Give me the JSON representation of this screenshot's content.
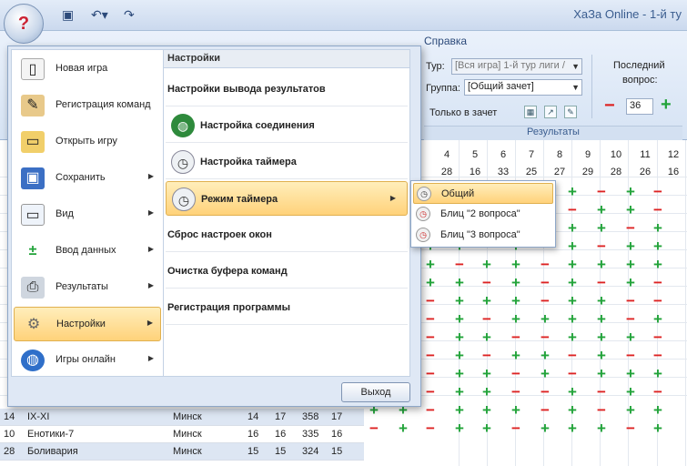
{
  "window": {
    "title": "ХаЗа Online - 1-й ту"
  },
  "orb": {
    "glyph": "?"
  },
  "qat": {
    "save_icon": "floppy-icon",
    "undo_icon": "undo-icon",
    "redo_icon": "redo-icon"
  },
  "ribbon": {
    "tab_help": "Справка",
    "tour_label": "Тур:",
    "tour_value": "[Вся игра] 1-й тур лиги /",
    "group_label": "Группа:",
    "group_value": "[Общий зачет]",
    "only_scoring": "Только в зачет",
    "last_question_label1": "Последний",
    "last_question_label2": "вопрос:",
    "last_question_value": "36",
    "minus_glyph": "−",
    "plus_glyph": "+",
    "results_caption": "Результаты"
  },
  "grid": {
    "question_numbers": [
      "4",
      "5",
      "6",
      "7",
      "8",
      "9",
      "10",
      "11",
      "12"
    ],
    "answer_counts": [
      "28",
      "16",
      "33",
      "25",
      "27",
      "29",
      "28",
      "26",
      "16"
    ],
    "rows": [
      {
        "place": "14",
        "team": "IX-XI",
        "city": "Минск",
        "c1": "14",
        "c2": "17",
        "c3": "358",
        "c4": "17"
      },
      {
        "place": "10",
        "team": "Енотики-7",
        "city": "Минск",
        "c1": "16",
        "c2": "16",
        "c3": "335",
        "c4": "16"
      },
      {
        "place": "28",
        "team": "Боливария",
        "city": "Минск",
        "c1": "15",
        "c2": "15",
        "c3": "324",
        "c4": "15"
      }
    ]
  },
  "menu": {
    "left_items": [
      {
        "label": "Новая игра",
        "icon": "document-icon"
      },
      {
        "label": "Регистрация команд",
        "icon": "clipboard-icon"
      },
      {
        "label": "Открыть игру",
        "icon": "folder-icon"
      },
      {
        "label": "Сохранить",
        "icon": "floppy-icon"
      },
      {
        "label": "Вид",
        "icon": "presentation-icon"
      },
      {
        "label": "Ввод данных",
        "icon": "plus-minus-icon"
      },
      {
        "label": "Результаты",
        "icon": "printer-icon"
      },
      {
        "label": "Настройки",
        "icon": "gear-icon"
      },
      {
        "label": "Игры онлайн",
        "icon": "globe-icon"
      }
    ],
    "right_header": "Настройки",
    "right_items": [
      {
        "label": "Настройки вывода результатов"
      },
      {
        "label": "Настройка соединения",
        "icon": "globe-icon"
      },
      {
        "label": "Настройка таймера",
        "icon": "stopwatch-icon"
      },
      {
        "label": "Режим таймера",
        "icon": "stopwatch-icon"
      },
      {
        "label": "Сброс настроек окон"
      },
      {
        "label": "Очистка буфера команд"
      },
      {
        "label": "Регистрация программы"
      }
    ],
    "exit_label": "Выход"
  },
  "submenu": {
    "items": [
      {
        "label": "Общий",
        "icon": "stopwatch-icon"
      },
      {
        "label": "Блиц \"2 вопроса\"",
        "icon": "alarm-clock-icon"
      },
      {
        "label": "Блиц \"3 вопроса\"",
        "icon": "alarm-clock-icon"
      }
    ]
  },
  "colors": {
    "plus": "#22a33a",
    "minus": "#d22",
    "highlight": "#ffd27a"
  }
}
